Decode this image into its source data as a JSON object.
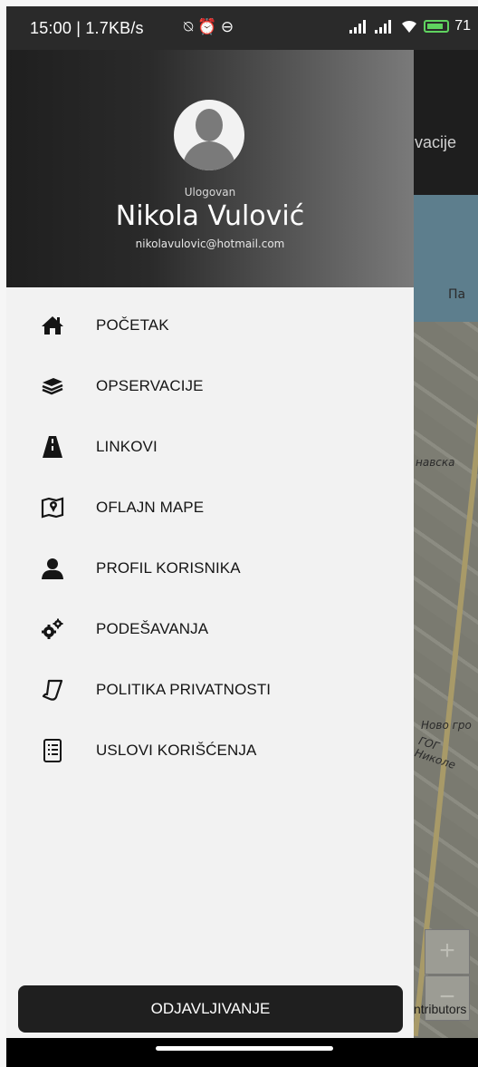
{
  "status_bar": {
    "time_speed": "15:00 | 1.7KB/s",
    "battery_percent": "71",
    "icons": [
      "silent-mode-icon",
      "alarm-icon",
      "sim-icon",
      "signal-icon",
      "signal-icon",
      "wifi-icon",
      "battery-charging-icon"
    ]
  },
  "background_map": {
    "tab_partial": "vacije",
    "labels": [
      "Па",
      "нaвска",
      "Ново гро",
      "ГОГ Николе"
    ],
    "attribution_partial": "ntributors",
    "zoom_in": "+",
    "zoom_out": "−"
  },
  "drawer": {
    "header": {
      "logged_label": "Ulogovan",
      "user_name": "Nikola Vulović",
      "user_email": "nikolavulovic@hotmail.com"
    },
    "menu": [
      {
        "label": "POČETAK",
        "icon": "home-icon"
      },
      {
        "label": "OPSERVACIJE",
        "icon": "layers-icon"
      },
      {
        "label": "LINKOVI",
        "icon": "road-icon"
      },
      {
        "label": "OFLAJN MAPE",
        "icon": "map-pin-icon"
      },
      {
        "label": "PROFIL KORISNIKA",
        "icon": "user-icon"
      },
      {
        "label": "PODEŠAVANJA",
        "icon": "gears-icon"
      },
      {
        "label": "POLITIKA PRIVATNOSTI",
        "icon": "document-curl-icon"
      },
      {
        "label": "USLOVI KORIŠĆENJA",
        "icon": "list-document-icon"
      }
    ],
    "logout_label": "ODJAVLJIVANJE"
  },
  "colors": {
    "header_dark": "#1f1f1f",
    "drawer_bg": "#f2f2f2",
    "button_bg": "#1f1f1f",
    "battery": "#5fd35f"
  }
}
